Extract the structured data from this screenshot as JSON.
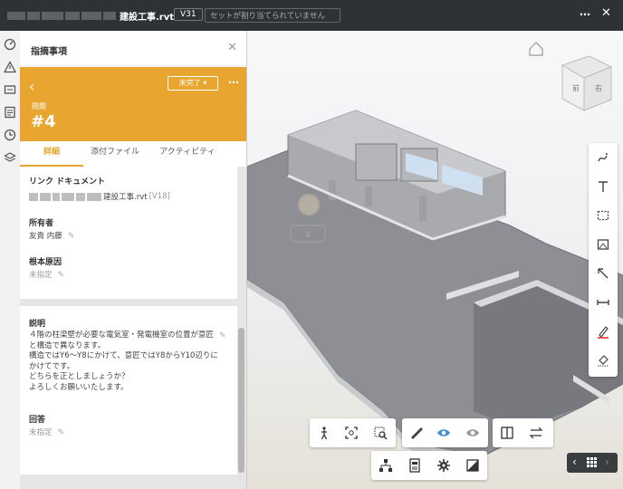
{
  "topbar": {
    "file_name": "建設工事.rvt",
    "version": "V31",
    "set_status": "セットが割り当てられていません"
  },
  "panel": {
    "title": "指摘事項",
    "status_label": "未完了",
    "issue_type": "問題",
    "issue_number": "#4",
    "tabs": [
      "詳細",
      "添付ファイル",
      "アクティビティ"
    ],
    "linked_doc_label": "リンク ドキュメント",
    "linked_doc_file": "建設工事.rvt",
    "linked_doc_version": "[V18]",
    "owner_label": "所有者",
    "owner_value": "友貴 内藤",
    "root_cause_label": "根本原因",
    "root_cause_value": "未指定",
    "description_label": "説明",
    "description_lines": [
      "４階の柱梁壁が必要な電気室・発電機室の位置が意匠",
      "と構造で異なります。",
      "構造ではY6～Y8にかけて、意匠ではY8からY10辺りに",
      "かけてです。",
      "どちらを正としましょうか？",
      "よろしくお願いいたします。"
    ],
    "reply_label": "回答",
    "reply_value": "未指定"
  },
  "viewer": {
    "pin_label": "4",
    "cube_faces": [
      "前",
      "右"
    ]
  }
}
